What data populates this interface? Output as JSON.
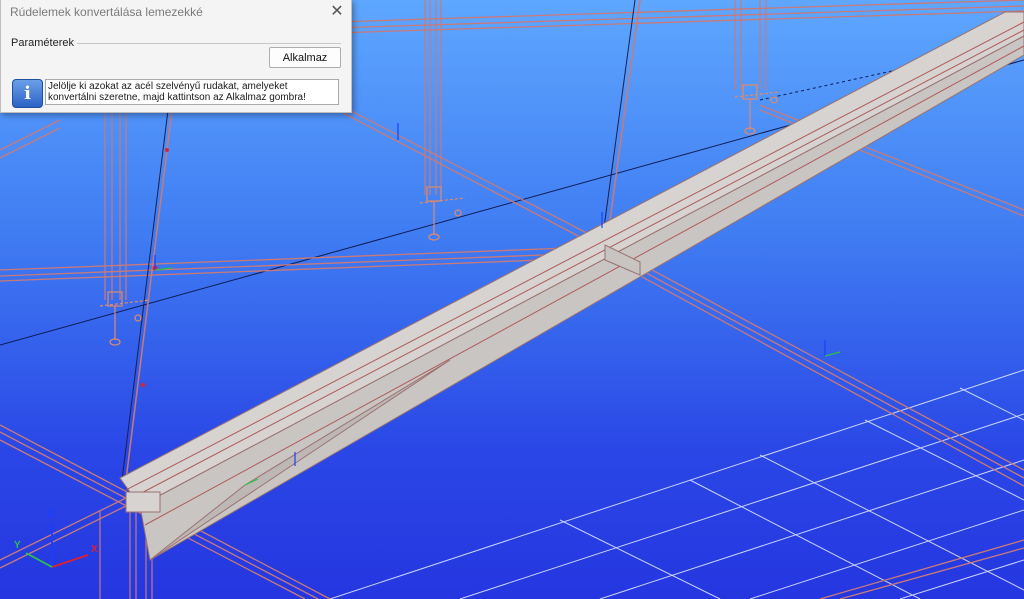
{
  "dialog": {
    "title": "Rúdelemek konvertálása lemezekké",
    "close_glyph": "✕",
    "section_label": "Paraméterek",
    "apply_label": "Alkalmaz",
    "info_icon": "info-icon",
    "info_glyph": "i",
    "instruction": "Jelölje ki azokat az acél szelvényű rudakat, amelyeket konvertálni szeretne, majd kattintson az Alkalmaz gombra!"
  },
  "axes": {
    "x": "X",
    "y": "Y",
    "z": "Z"
  },
  "colors": {
    "background_top": "#5ea7ff",
    "background_bottom": "#2536e0",
    "member_outline": "#c87a78",
    "beam_face": "#d4d2d0",
    "grid": "#e6ecff"
  }
}
